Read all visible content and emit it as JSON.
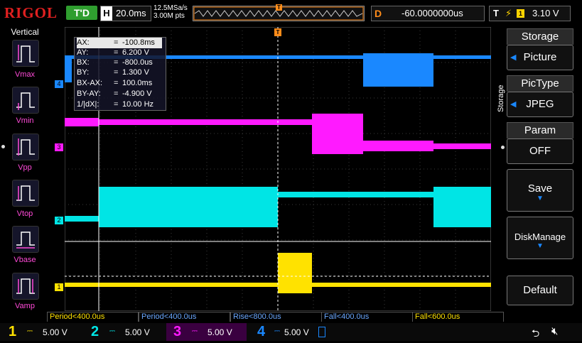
{
  "topbar": {
    "brand": "RIGOL",
    "trigger_status": "T'D",
    "timebase_letter": "H",
    "timebase": "20.0ms",
    "sample_rate": "12.5MSa/s",
    "memory_depth": "3.00M pts",
    "delay_letter": "D",
    "delay": "-60.0000000us",
    "trigger_letter": "T",
    "trigger_source": "1",
    "trigger_level": "3.10 V"
  },
  "left_panel": {
    "title": "Vertical",
    "items": [
      {
        "label": "Vmax",
        "icon": "vmax-icon"
      },
      {
        "label": "Vmin",
        "icon": "vmin-icon"
      },
      {
        "label": "Vpp",
        "icon": "vpp-icon"
      },
      {
        "label": "Vtop",
        "icon": "vtop-icon"
      },
      {
        "label": "Vbase",
        "icon": "vbase-icon"
      },
      {
        "label": "Vamp",
        "icon": "vamp-icon"
      }
    ]
  },
  "cursor": {
    "rows": [
      {
        "key": "AX:",
        "value": "-100.8ms"
      },
      {
        "key": "AY:",
        "value": "6.200 V"
      },
      {
        "key": "BX:",
        "value": "-800.0us"
      },
      {
        "key": "BY:",
        "value": "1.300 V"
      },
      {
        "key": "BX-AX:",
        "value": "100.0ms"
      },
      {
        "key": "BY-AY:",
        "value": "-4.900 V"
      },
      {
        "key": "1/|dX|:",
        "value": "10.00 Hz"
      }
    ]
  },
  "waveforms": {
    "ch1_marker": "1",
    "ch2_marker": "2",
    "ch3_marker": "3",
    "ch4_marker": "4",
    "trigger_marker": "T"
  },
  "measurements": [
    {
      "text": "Period<400.0us",
      "color": "#ffe200"
    },
    {
      "text": "Period<400.0us",
      "color": "#6aa8ff"
    },
    {
      "text": "Rise<800.0us",
      "color": "#6aa8ff"
    },
    {
      "text": "Fall<400.0us",
      "color": "#6aa8ff"
    },
    {
      "text": "Fall<600.0us",
      "color": "#ffe200"
    }
  ],
  "channels": [
    {
      "num": "1",
      "scale": "5.00 V",
      "color": "#ffe200"
    },
    {
      "num": "2",
      "scale": "5.00 V",
      "color": "#00e5e5"
    },
    {
      "num": "3",
      "scale": "5.00 V",
      "color": "#ff1aff"
    },
    {
      "num": "4",
      "scale": "5.00 V",
      "color": "#1a88ff"
    }
  ],
  "right_panel": {
    "side_label": "Storage",
    "storage_title": "Storage",
    "storage_value": "Picture",
    "pictype_title": "PicType",
    "pictype_value": "JPEG",
    "param_title": "Param",
    "param_value": "OFF",
    "save_label": "Save",
    "diskmanage_label": "DiskManage",
    "default_label": "Default"
  },
  "colors": {
    "ch1": "#ffe200",
    "ch2": "#00e5e5",
    "ch3": "#ff1aff",
    "ch4": "#1a88ff",
    "accent_orange": "#ff8c1a"
  }
}
